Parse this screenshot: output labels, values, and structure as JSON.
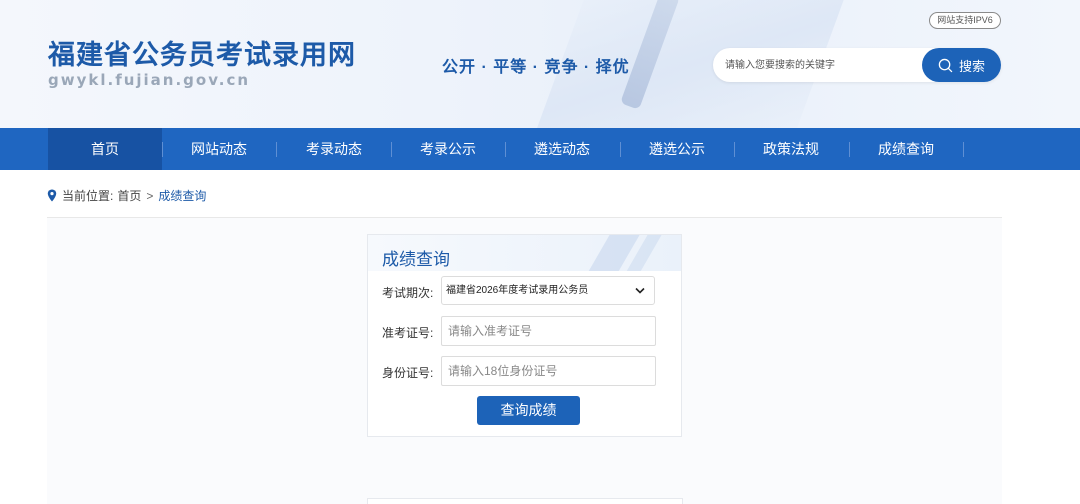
{
  "header": {
    "site_title": "福建省公务员考试录用网",
    "site_domain": "gwykl.fujian.gov.cn",
    "slogan": "公开 · 平等 · 竞争 · 择优",
    "ipv6_badge": "网站支持IPV6",
    "search": {
      "placeholder": "请输入您要搜索的关键字",
      "button_label": "搜索"
    }
  },
  "nav": {
    "items": [
      {
        "label": "首页",
        "active": true
      },
      {
        "label": "网站动态"
      },
      {
        "label": "考录动态"
      },
      {
        "label": "考录公示"
      },
      {
        "label": "遴选动态"
      },
      {
        "label": "遴选公示"
      },
      {
        "label": "政策法规"
      },
      {
        "label": "成绩查询"
      }
    ]
  },
  "breadcrumb": {
    "prefix": "当前位置:",
    "home": "首页",
    "separator": ">",
    "current": "成绩查询"
  },
  "query_form": {
    "title": "成绩查询",
    "exam_period_label": "考试期次:",
    "exam_period_value": "福建省2026年度考试录用公务员",
    "ticket_label": "准考证号:",
    "ticket_placeholder": "请输入准考证号",
    "id_label": "身份证号:",
    "id_placeholder": "请输入18位身份证号",
    "submit_label": "查询成绩"
  },
  "colors": {
    "brand_blue": "#1d5aa8",
    "nav_blue": "#1f66c1",
    "nav_active": "#1752a3",
    "button_blue": "#1d63b8"
  }
}
